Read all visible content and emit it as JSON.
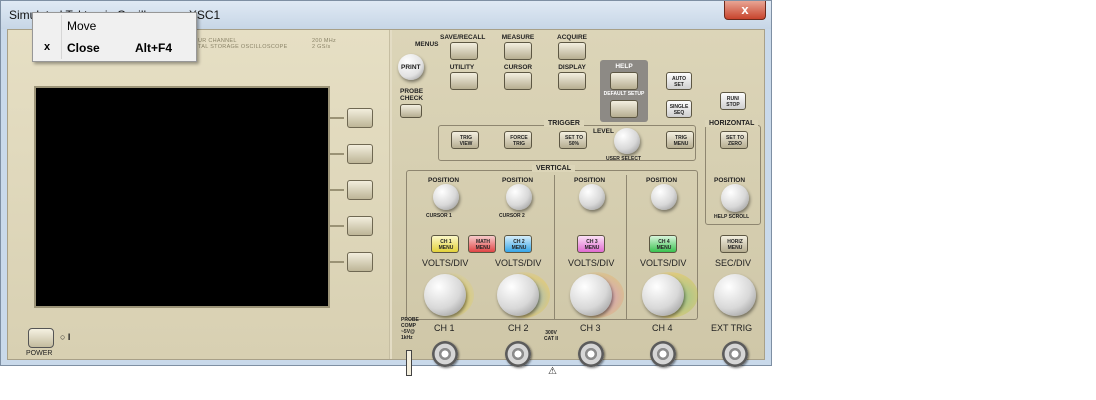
{
  "window": {
    "title": "Simulated Tektronix Oscilloscope-XSC1",
    "close_glyph": "x"
  },
  "context_menu": {
    "items": [
      {
        "label": "Move",
        "shortcut": "",
        "mark": ""
      },
      {
        "label": "Close",
        "shortcut": "Alt+F4",
        "mark": "x"
      }
    ]
  },
  "scope": {
    "brand_line1": "UR CHANNEL",
    "brand_line2": "TAL STORAGE OSCILLOSCOPE",
    "spec_line1": "200 MHz",
    "spec_line2": "2 GS/s",
    "power_label": "POWER",
    "print_label": "PRINT",
    "probe_check_label": "PROBE\nCHECK",
    "menus_label": "MENUS",
    "menu_buttons": [
      {
        "label": "SAVE/RECALL"
      },
      {
        "label": "MEASURE"
      },
      {
        "label": "ACQUIRE"
      },
      {
        "label": "HELP"
      },
      {
        "label": "UTILITY"
      },
      {
        "label": "CURSOR"
      },
      {
        "label": "DISPLAY"
      },
      {
        "label": "DEFAULT SETUP"
      }
    ],
    "autoset_label": "AUTO\nSET",
    "single_seq_label": "SINGLE\nSEQ",
    "run_stop_label": "RUN/\nSTOP",
    "trigger": {
      "title": "TRIGGER",
      "trig_view": "TRIG\nVIEW",
      "force_trig": "FORCE\nTRIG",
      "set_to_50": "SET TO\n50%",
      "level_label": "LEVEL",
      "user_select": "USER SELECT",
      "trig_menu": "TRIG\nMENU"
    },
    "horizontal": {
      "title": "HORIZONTAL",
      "set_to_zero": "SET TO\nZERO",
      "position_label": "POSITION",
      "help_scroll": "HELP SCROLL",
      "horiz_menu": "HORIZ\nMENU",
      "sec_div": "SEC/DIV",
      "ext_trig": "EXT TRIG"
    },
    "vertical": {
      "title": "VERTICAL",
      "math_menu": "MATH\nMENU",
      "cat_rating": "300V\nCAT II",
      "channels": [
        {
          "position": "POSITION",
          "cursor": "CURSOR 1",
          "menu": "CH 1\nMENU",
          "volts": "VOLTS/DIV",
          "input": "CH 1",
          "color": "#f2d600"
        },
        {
          "position": "POSITION",
          "cursor": "CURSOR 2",
          "menu": "CH 2\nMENU",
          "volts": "VOLTS/DIV",
          "input": "CH 2",
          "color": "#36a6e8"
        },
        {
          "position": "POSITION",
          "cursor": "",
          "menu": "CH 3\nMENU",
          "volts": "VOLTS/DIV",
          "input": "CH 3",
          "color": "#e06ad0"
        },
        {
          "position": "POSITION",
          "cursor": "",
          "menu": "CH 4\nMENU",
          "volts": "VOLTS/DIV",
          "input": "CH 4",
          "color": "#39c24f"
        }
      ]
    },
    "probe_comp": "PROBE\nCOMP\n~5V@\n1kHz"
  },
  "colors": {
    "panel": "#e3dcc0",
    "screen": "#000000",
    "math": "#e04545"
  }
}
